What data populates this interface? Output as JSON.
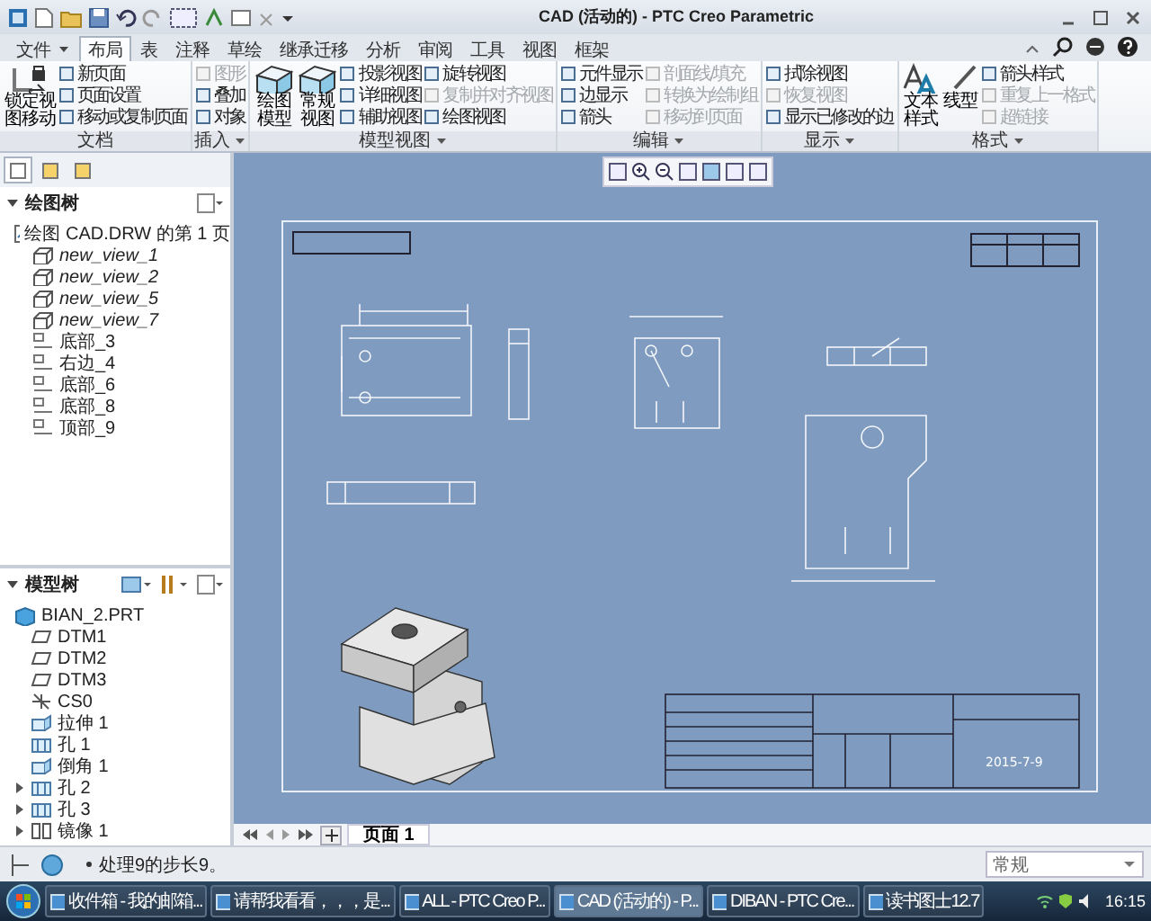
{
  "window": {
    "title": "CAD (活动的) - PTC Creo Parametric"
  },
  "tabs": [
    {
      "label": "文件",
      "selected": false,
      "dropdown": true
    },
    {
      "label": "布局",
      "selected": true,
      "dropdown": false
    },
    {
      "label": "表",
      "selected": false,
      "dropdown": false
    },
    {
      "label": "注释",
      "selected": false,
      "dropdown": false
    },
    {
      "label": "草绘",
      "selected": false,
      "dropdown": false
    },
    {
      "label": "继承迁移",
      "selected": false,
      "dropdown": false
    },
    {
      "label": "分析",
      "selected": false,
      "dropdown": false
    },
    {
      "label": "审阅",
      "selected": false,
      "dropdown": false
    },
    {
      "label": "工具",
      "selected": false,
      "dropdown": false
    },
    {
      "label": "视图",
      "selected": false,
      "dropdown": false
    },
    {
      "label": "框架",
      "selected": false,
      "dropdown": false
    }
  ],
  "ribbon_groups": [
    {
      "label": "文档",
      "dropdown": false,
      "large": [
        {
          "label": "锁定视图移动",
          "kind": "lock"
        }
      ],
      "columns": [
        [
          {
            "label": "新页面",
            "disabled": false
          },
          {
            "label": "页面设置",
            "disabled": false
          },
          {
            "label": "移动或复制页面",
            "disabled": false
          }
        ]
      ]
    },
    {
      "label": "插入",
      "dropdown": true,
      "columns": [
        [
          {
            "label": "图形",
            "disabled": true
          },
          {
            "label": "叠加",
            "disabled": false
          },
          {
            "label": "对象",
            "disabled": false
          }
        ]
      ]
    },
    {
      "label": "模型视图",
      "dropdown": true,
      "large": [
        {
          "label": "绘图模型",
          "kind": "cube"
        },
        {
          "label": "常规视图",
          "kind": "cube"
        }
      ],
      "columns": [
        [
          {
            "label": "投影视图",
            "disabled": false
          },
          {
            "label": "详细视图",
            "disabled": false
          },
          {
            "label": "辅助视图",
            "disabled": false
          }
        ],
        [
          {
            "label": "旋转视图",
            "disabled": false
          },
          {
            "label": "复制并对齐视图",
            "disabled": true
          },
          {
            "label": "绘图视图",
            "disabled": false
          }
        ]
      ]
    },
    {
      "label": "编辑",
      "dropdown": true,
      "columns": [
        [
          {
            "label": "元件显示",
            "disabled": false
          },
          {
            "label": "边显示",
            "disabled": false
          },
          {
            "label": "箭头",
            "disabled": false
          }
        ],
        [
          {
            "label": "剖面线/填充",
            "disabled": true
          },
          {
            "label": "转换为绘制组",
            "disabled": true
          },
          {
            "label": "移动到页面",
            "disabled": true
          }
        ]
      ]
    },
    {
      "label": "显示",
      "dropdown": true,
      "columns": [
        [
          {
            "label": "拭除视图",
            "disabled": false
          },
          {
            "label": "恢复视图",
            "disabled": true
          },
          {
            "label": "显示已修改的边",
            "disabled": false
          }
        ]
      ]
    },
    {
      "label": "格式",
      "dropdown": true,
      "large": [
        {
          "label": "文本样式",
          "kind": "text"
        },
        {
          "label": "线型",
          "kind": "pen"
        }
      ],
      "columns": [
        [
          {
            "label": "箭头样式",
            "disabled": false
          },
          {
            "label": "重复上一格式",
            "disabled": true
          },
          {
            "label": "超链接",
            "disabled": true
          }
        ]
      ]
    }
  ],
  "panel_tabs": [
    {
      "selected": true
    },
    {
      "selected": false
    },
    {
      "selected": false
    }
  ],
  "drawing_tree": {
    "title": "绘图树",
    "root": {
      "label": "绘图 CAD.DRW 的第 1 页",
      "children": [
        {
          "label": "new_view_1",
          "kind": "view"
        },
        {
          "label": "new_view_2",
          "kind": "view"
        },
        {
          "label": "new_view_5",
          "kind": "view"
        },
        {
          "label": "new_view_7",
          "kind": "view"
        },
        {
          "label": "底部_3",
          "kind": "table"
        },
        {
          "label": "右边_4",
          "kind": "table"
        },
        {
          "label": "底部_6",
          "kind": "table"
        },
        {
          "label": "底部_8",
          "kind": "table"
        },
        {
          "label": "顶部_9",
          "kind": "table"
        }
      ]
    }
  },
  "model_tree": {
    "title": "模型树",
    "root": {
      "label": "BIAN_2.PRT",
      "children": [
        {
          "label": "DTM1",
          "kind": "plane",
          "collapsed": false
        },
        {
          "label": "DTM2",
          "kind": "plane",
          "collapsed": false
        },
        {
          "label": "DTM3",
          "kind": "plane",
          "collapsed": false
        },
        {
          "label": "CS0",
          "kind": "csys",
          "collapsed": false
        },
        {
          "label": "拉伸 1",
          "kind": "feature",
          "collapsed": false
        },
        {
          "label": "孔 1",
          "kind": "hole",
          "collapsed": false
        },
        {
          "label": "倒角 1",
          "kind": "feature",
          "collapsed": false
        },
        {
          "label": "孔 2",
          "kind": "hole",
          "collapsed": true
        },
        {
          "label": "孔 3",
          "kind": "hole",
          "collapsed": true
        },
        {
          "label": "镜像 1",
          "kind": "mirror",
          "collapsed": true
        }
      ]
    }
  },
  "sheet": {
    "date": "2015-7-9"
  },
  "pages": [
    {
      "label": "页面 1",
      "selected": true
    }
  ],
  "status_bar": {
    "message": "处理9的步长9。",
    "filter": "常规"
  },
  "taskbar": {
    "items": [
      {
        "label": "收件箱 - 我的邮箱...",
        "selected": false
      },
      {
        "label": "请帮我看看，，，是...",
        "selected": false
      },
      {
        "label": "ALL - PTC Creo P...",
        "selected": false
      },
      {
        "label": "CAD (活动的) - P...",
        "selected": true
      },
      {
        "label": "DIBAN - PTC Cre...",
        "selected": false
      },
      {
        "label": "读书图士12.7",
        "selected": false
      }
    ],
    "time": "16:15"
  }
}
